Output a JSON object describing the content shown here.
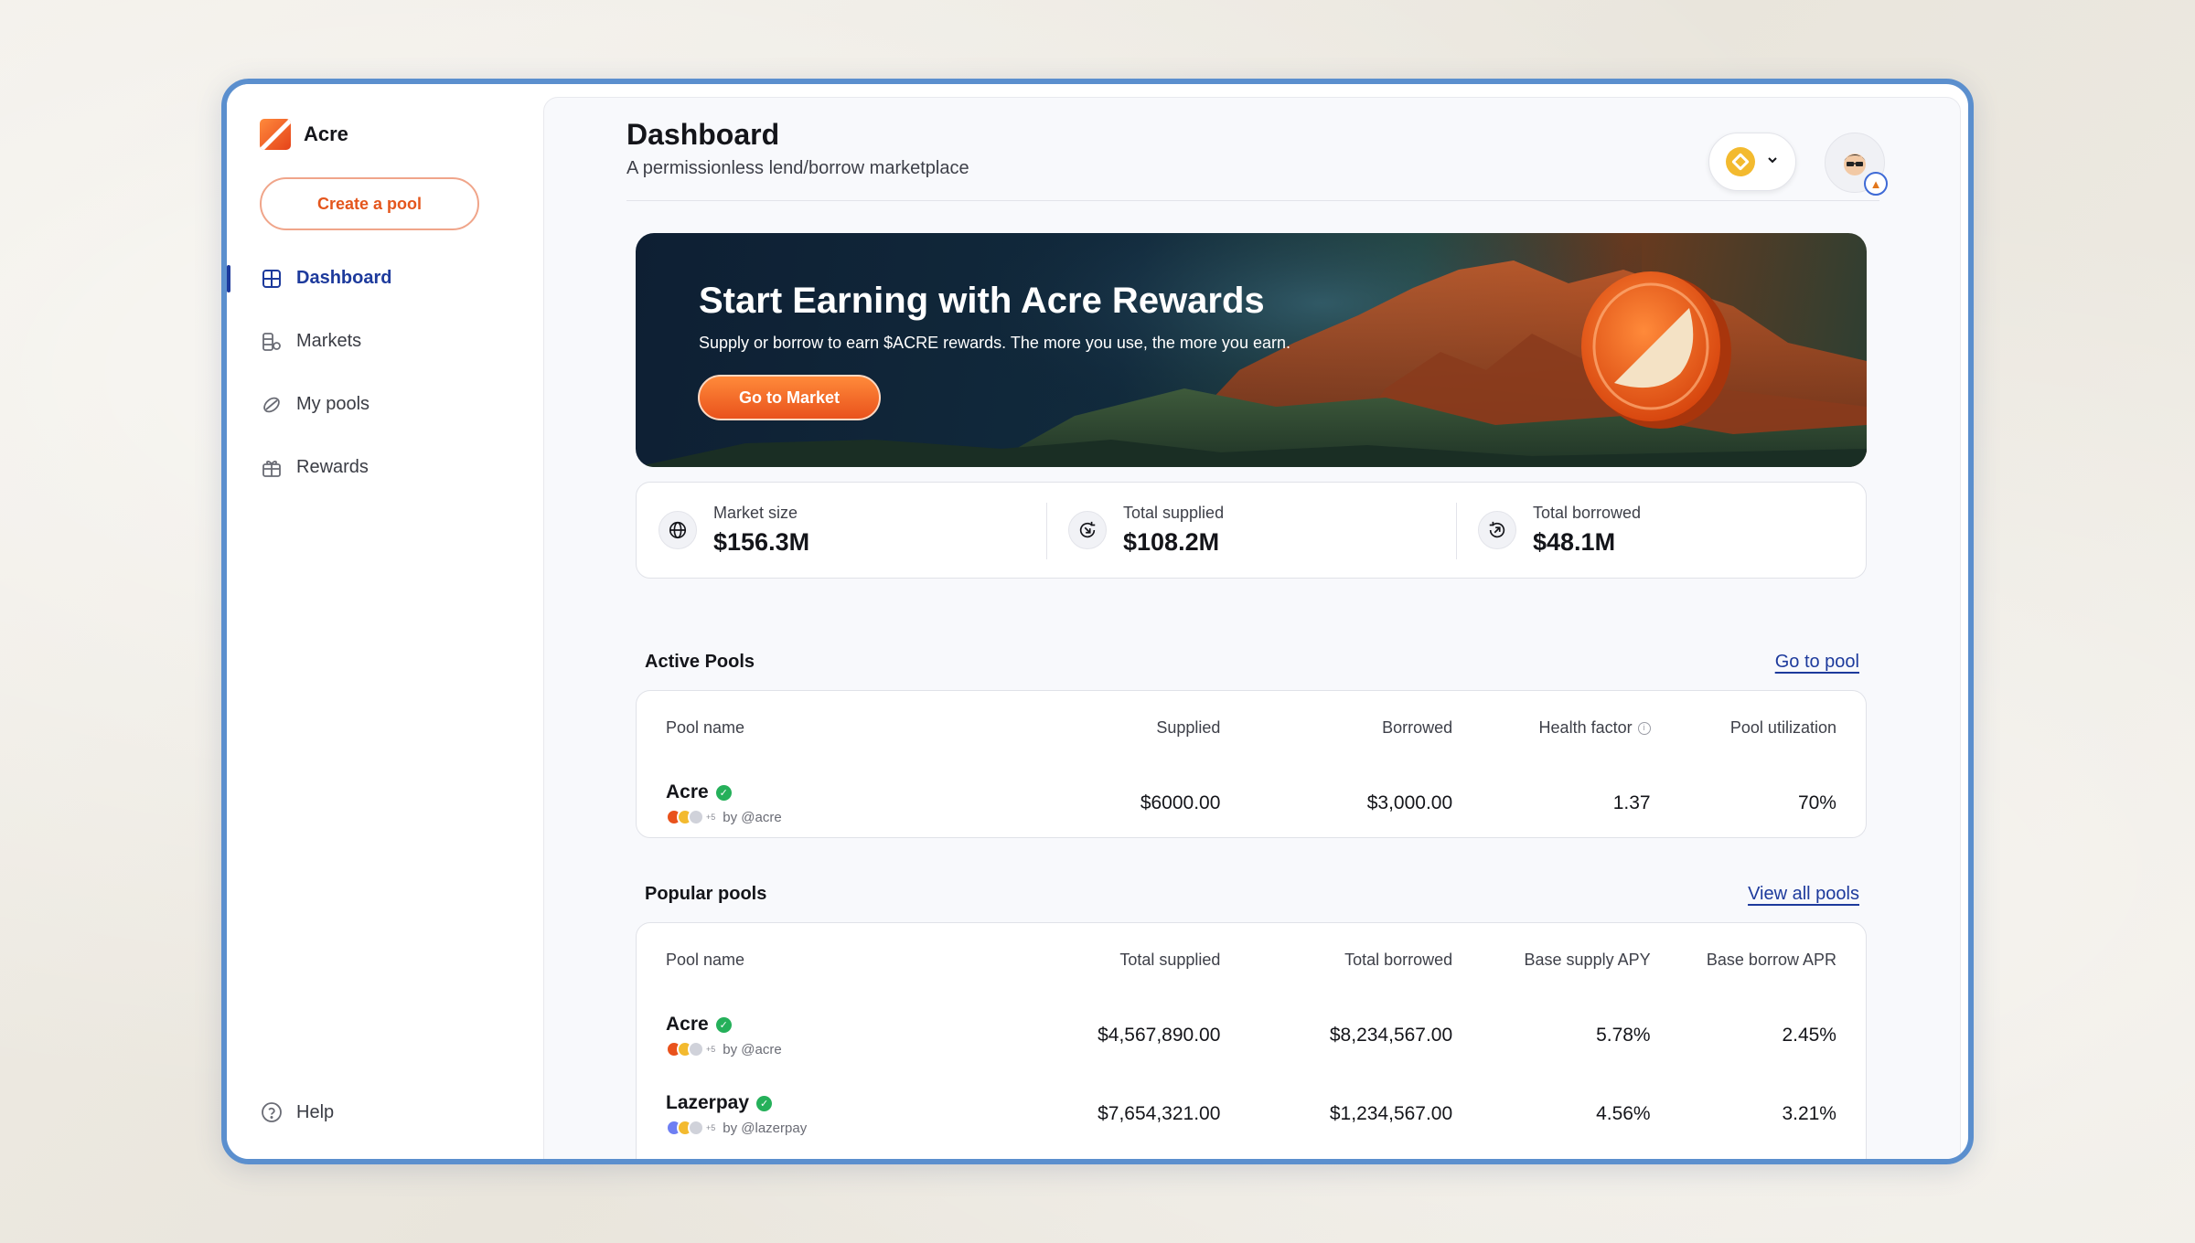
{
  "brand": {
    "name": "Acre"
  },
  "sidebar": {
    "create_label": "Create a pool",
    "items": [
      {
        "label": "Dashboard",
        "icon": "dashboard-icon",
        "active": true
      },
      {
        "label": "Markets",
        "icon": "markets-icon",
        "active": false
      },
      {
        "label": "My pools",
        "icon": "pools-icon",
        "active": false
      },
      {
        "label": "Rewards",
        "icon": "gift-icon",
        "active": false
      }
    ],
    "help_label": "Help"
  },
  "header": {
    "title": "Dashboard",
    "subtitle": "A permissionless lend/borrow marketplace"
  },
  "banner": {
    "title": "Start Earning with Acre Rewards",
    "subtitle": "Supply or borrow to earn $ACRE rewards. The more you use, the more you earn.",
    "button_label": "Go to Market"
  },
  "stats": [
    {
      "label": "Market size",
      "value": "$156.3M",
      "icon": "globe-icon"
    },
    {
      "label": "Total supplied",
      "value": "$108.2M",
      "icon": "supply-icon"
    },
    {
      "label": "Total borrowed",
      "value": "$48.1M",
      "icon": "borrow-icon"
    }
  ],
  "active_pools": {
    "title": "Active Pools",
    "link": "Go to pool",
    "columns": [
      "Pool name",
      "Supplied",
      "Borrowed",
      "Health factor",
      "Pool utilization"
    ],
    "rows": [
      {
        "name": "Acre",
        "by": "by @acre",
        "more": "+5",
        "supplied": "$6000.00",
        "borrowed": "$3,000.00",
        "health": "1.37",
        "utilization": "70%"
      }
    ]
  },
  "popular_pools": {
    "title": "Popular pools",
    "link": "View all pools",
    "columns": [
      "Pool name",
      "Total supplied",
      "Total borrowed",
      "Base supply APY",
      "Base borrow APR"
    ],
    "rows": [
      {
        "name": "Acre",
        "by": "by @acre",
        "more": "+5",
        "supplied": "$4,567,890.00",
        "borrowed": "$8,234,567.00",
        "apy": "5.78%",
        "apr": "2.45%"
      },
      {
        "name": "Lazerpay",
        "by": "by @lazerpay",
        "more": "+5",
        "supplied": "$7,654,321.00",
        "borrowed": "$1,234,567.00",
        "apy": "4.56%",
        "apr": "3.21%"
      }
    ]
  },
  "colors": {
    "accent": "#1d3a9c",
    "brand_orange": "#e9521c",
    "frame_border": "#5b8fce",
    "verified": "#25b05a"
  }
}
